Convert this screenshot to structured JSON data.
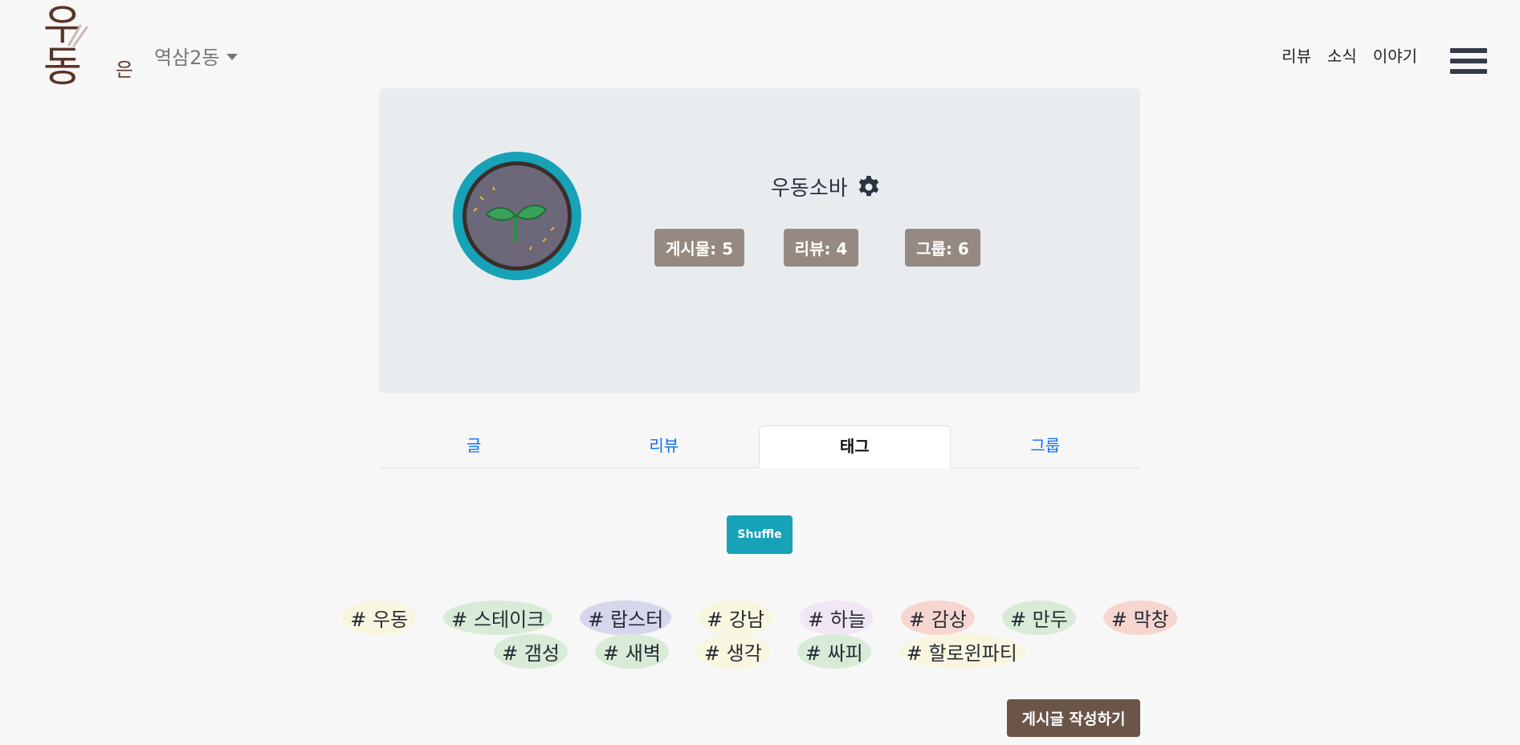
{
  "header": {
    "logo_text": "우동",
    "logo_suffix": "은",
    "location": "역삼2동",
    "nav": [
      "리뷰",
      "소식",
      "이야기"
    ]
  },
  "profile": {
    "username": "우동소바",
    "stats": {
      "posts": "게시물: 5",
      "reviews": "리뷰: 4",
      "groups": "그룹: 6"
    }
  },
  "tabs": [
    {
      "label": "글",
      "active": false
    },
    {
      "label": "리뷰",
      "active": false
    },
    {
      "label": "태그",
      "active": true
    },
    {
      "label": "그룹",
      "active": false
    }
  ],
  "shuffle_label": "Shuffle",
  "tags_row1": [
    {
      "text": "# 우동",
      "color": "#f9f6df"
    },
    {
      "text": "# 스테이크",
      "color": "#d7ebd7"
    },
    {
      "text": "# 랍스터",
      "color": "#d6d6ec"
    },
    {
      "text": "# 강남",
      "color": "#f9f6df"
    },
    {
      "text": "# 하늘",
      "color": "#f1e6f3"
    },
    {
      "text": "# 감상",
      "color": "#f7d6d0"
    },
    {
      "text": "# 만두",
      "color": "#d7ebd7"
    },
    {
      "text": "# 막창",
      "color": "#f7d6d0"
    }
  ],
  "tags_row2": [
    {
      "text": "# 갬성",
      "color": "#d7ebd7"
    },
    {
      "text": "# 새벽",
      "color": "#d7ebd7"
    },
    {
      "text": "# 생각",
      "color": "#f9f6df"
    },
    {
      "text": "# 싸피",
      "color": "#d7ebd7"
    },
    {
      "text": "# 할로윈파티",
      "color": "#f9f6df"
    }
  ],
  "write_button": "게시글 작성하기",
  "colors": {
    "accent_teal": "#17a2b8",
    "stat_badge": "#968981",
    "write_button": "#6b5548",
    "logo_brown": "#5b3426"
  }
}
